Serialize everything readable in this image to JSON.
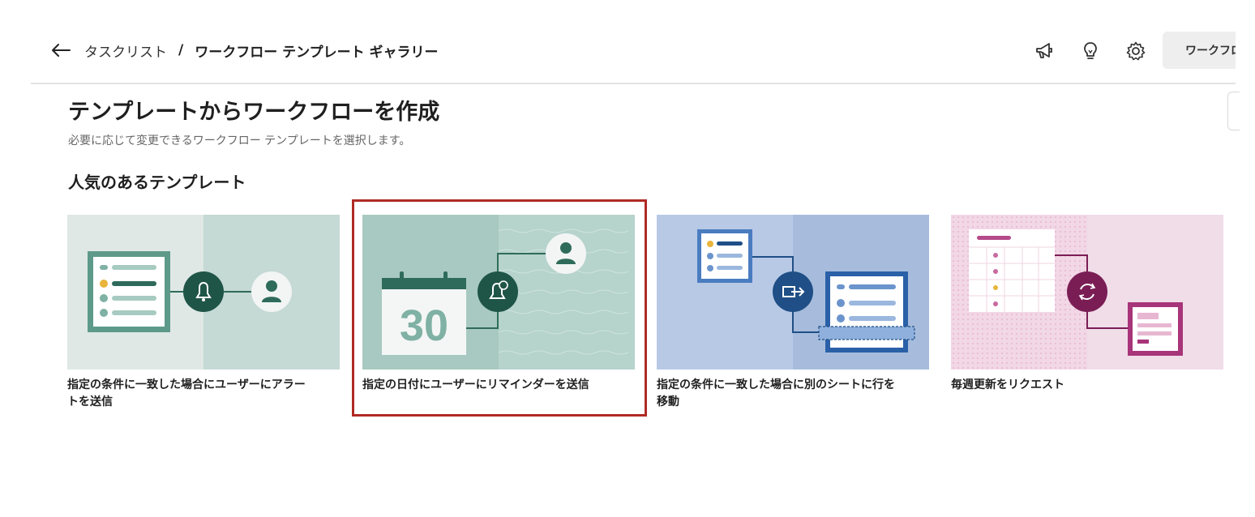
{
  "header": {
    "breadcrumb_parent": "タスクリスト",
    "breadcrumb_separator": "/",
    "breadcrumb_current": "ワークフロー テンプレート ギャラリー",
    "button_label": "ワークフロー"
  },
  "icons": {
    "back": "arrow-left-icon",
    "announcements": "megaphone-icon",
    "tips": "lightbulb-icon",
    "settings": "gear-icon"
  },
  "page": {
    "title": "テンプレートからワークフローを作成",
    "subtitle": "必要に応じて変更できるワークフロー テンプレートを選択します。"
  },
  "section": {
    "title": "人気のあるテンプレート"
  },
  "cards": [
    {
      "title": "指定の条件に一致した場合にユーザーにアラートを送信",
      "accent": "#2f6b5a",
      "selected": false
    },
    {
      "title": "指定の日付にユーザーにリマインダーを送信",
      "calendar_number": "30",
      "accent": "#2f6b5a",
      "selected": true
    },
    {
      "title": "指定の条件に一致した場合に別のシートに行を移動",
      "accent": "#1f4f86",
      "selected": false
    },
    {
      "title": "毎週更新をリクエスト",
      "accent": "#7a1d55",
      "selected": false
    }
  ],
  "colors": {
    "selection_outline": "#b02a24",
    "header_button_bg": "#eeeeee",
    "divider": "#e3e3e3"
  }
}
